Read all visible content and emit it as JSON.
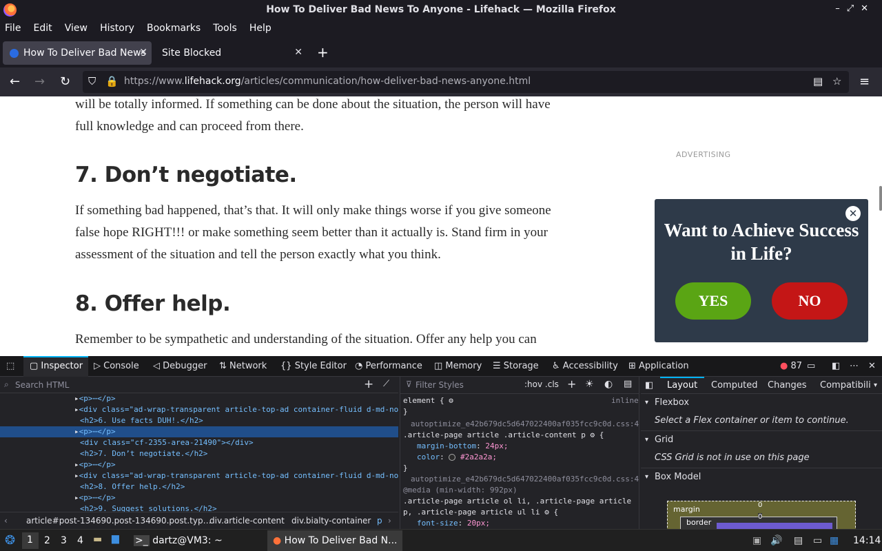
{
  "window": {
    "title": "How To Deliver Bad News To Anyone - Lifehack — Mozilla Firefox"
  },
  "menu": [
    "File",
    "Edit",
    "View",
    "History",
    "Bookmarks",
    "Tools",
    "Help"
  ],
  "tabs": [
    {
      "label": "How To Deliver Bad News",
      "active": true
    },
    {
      "label": "Site Blocked",
      "active": false
    }
  ],
  "url": {
    "prefix": "https://www.",
    "domain": "lifehack.org",
    "path": "/articles/communication/how-deliver-bad-news-anyone.html"
  },
  "article": {
    "intro": "will be totally informed. If something can be done about the situation, the person will have full knowledge and can proceed from there.",
    "h7": "7. Don’t negotiate.",
    "p7": "If something bad happened, that’s that. It will only make things worse if you give someone false hope RIGHT!!! or make something seem better than it actually is. Stand firm in your assessment of the situation and tell the person exactly what you think.",
    "h8": "8. Offer help.",
    "p8": "Remember to be sympathetic and understanding of the situation. Offer any help you can"
  },
  "advertising": "ADVERTISING",
  "popup": {
    "question": "Want to Achieve Success in Life?",
    "yes": "YES",
    "no": "NO"
  },
  "devtools": {
    "tabs": [
      "Inspector",
      "Console",
      "Debugger",
      "Network",
      "Style Editor",
      "Performance",
      "Memory",
      "Storage",
      "Accessibility",
      "Application"
    ],
    "error_count": "87",
    "search_html_placeholder": "Search HTML",
    "filter_styles_placeholder": "Filter Styles",
    "hov_cls": ":hov .cls",
    "html_lines": [
      "<p>⋯</p>",
      "<div class=\"ad-wrap-transparent article-top-ad container-fluid d-md-no",
      "<h2>6. Use facts DUH!.</h2>",
      "<p>⋯</p>",
      "<div class=\"cf-2355-area-21490\"></div>",
      "<h2>7. Don’t negotiate.</h2>",
      "<p>⋯</p>",
      "<div class=\"ad-wrap-transparent article-top-ad container-fluid d-md-no",
      "<h2>8. Offer help.</h2>",
      "<p>⋯</p>",
      "<h2>9. Suggest solutions.</h2>"
    ],
    "breadcrumbs": [
      "article#post-134690.post-134690.post.typ…",
      "div.article-content",
      "div.bialty-container",
      "p"
    ],
    "styles": {
      "element": "element {",
      "inline": "inline",
      "src1": "autoptimize_e42b679dc5d647022400af035fcc9c0d.css:4",
      "rule1": ".article-page article .article-content p",
      "decl1": [
        {
          "prop": "margin-bottom",
          "val": "24px;"
        },
        {
          "prop": "color",
          "val": "#2a2a2a;"
        }
      ],
      "src2": "autoptimize_e42b679dc5d647022400af035fcc9c0d.css:4",
      "media": "@media (min-width: 992px)",
      "rule2a": ".article-page article ol li, .article-page article",
      "rule2b": "p, .article-page article ul li",
      "decl2": [
        {
          "prop": "font-size",
          "val": "20px;"
        }
      ]
    },
    "layout_tabs": [
      "Layout",
      "Computed",
      "Changes",
      "Compatibili"
    ],
    "flexbox": "Flexbox",
    "flex_msg": "Select a Flex container or item to continue.",
    "grid": "Grid",
    "grid_msg": "CSS Grid is not in use on this page",
    "boxmodel": "Box Model",
    "margin_label": "margin",
    "margin_val": "0",
    "border_label": "border",
    "border_val": "0"
  },
  "taskbar": {
    "workspaces": [
      "1",
      "2",
      "3",
      "4"
    ],
    "terminal": "dartz@VM3: ~",
    "firefox": "How To Deliver Bad N...",
    "clock": "14:14"
  }
}
